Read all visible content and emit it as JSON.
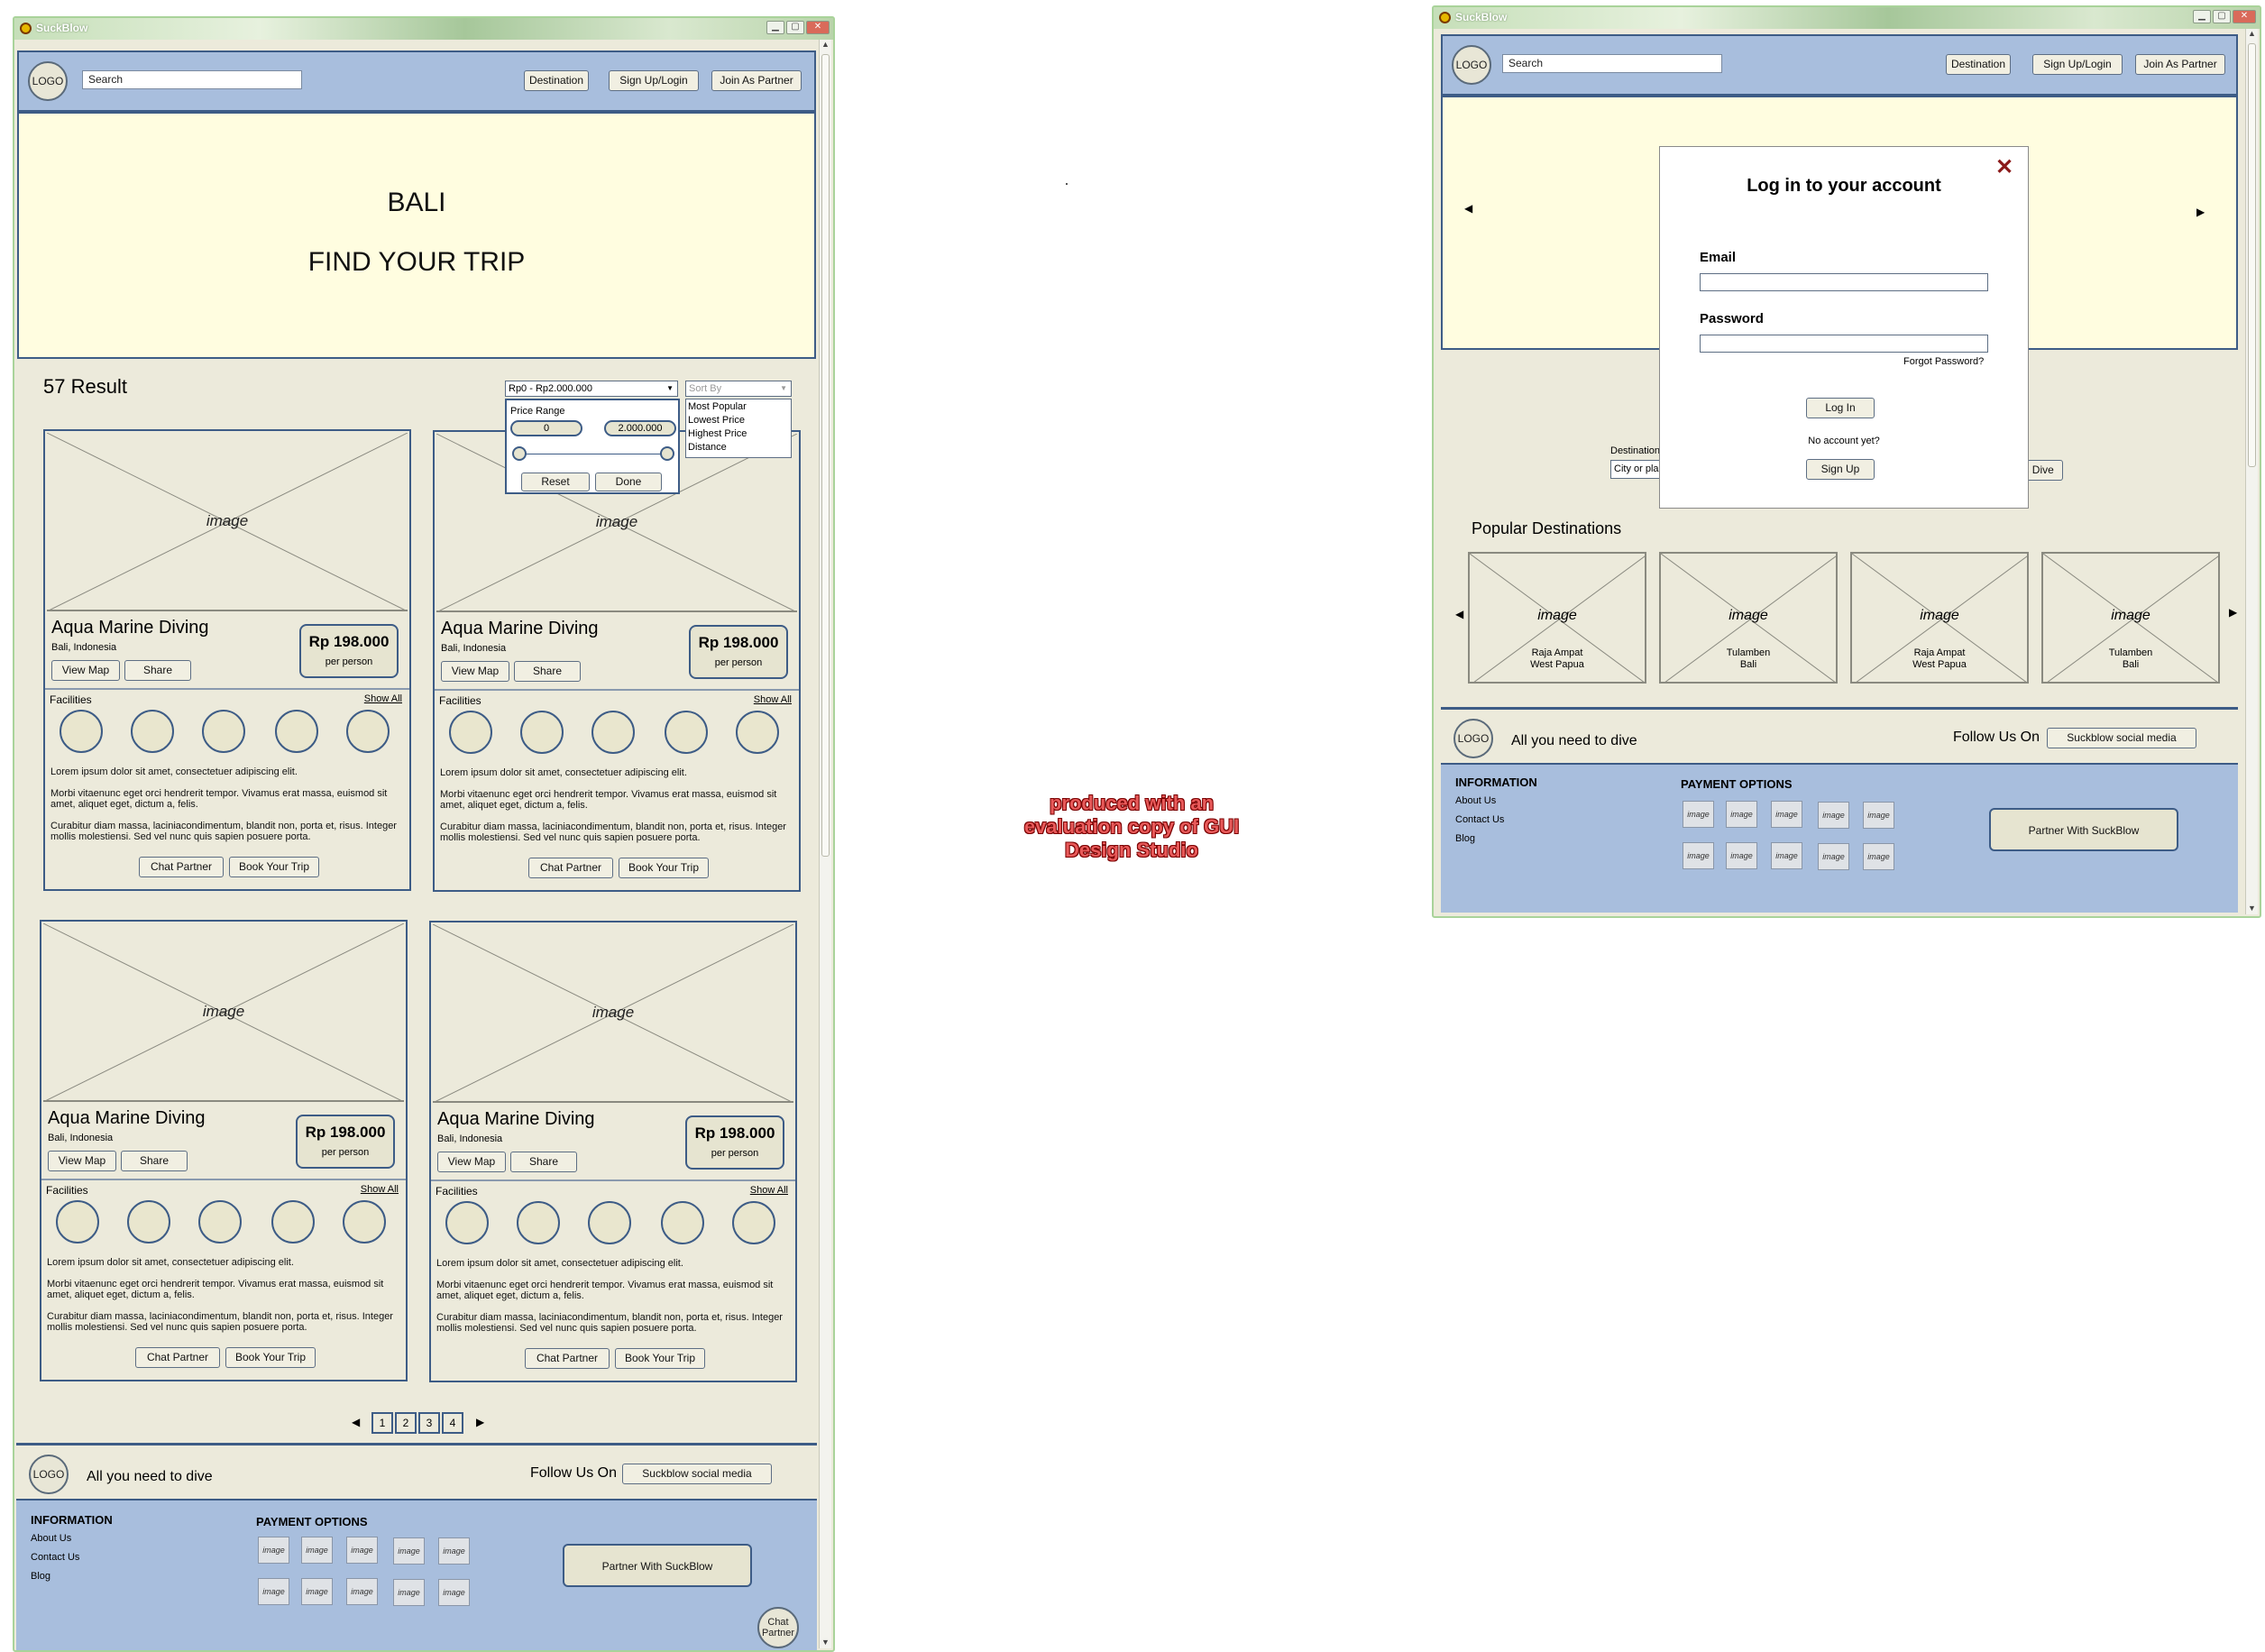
{
  "app": {
    "title": "SuckBlow"
  },
  "header": {
    "logo": "LOGO",
    "search_value": "Search",
    "destination": "Destination",
    "signup": "Sign Up/Login",
    "partner": "Join As Partner"
  },
  "hero": {
    "line1": "BALI",
    "line2": "FIND YOUR TRIP"
  },
  "results": {
    "count": "57 Result"
  },
  "filters": {
    "price_select": "Rp0 - Rp2.000.000",
    "sort_select": "Sort By",
    "price_panel": {
      "label": "Price Range",
      "min": "0",
      "max": "2.000.000",
      "reset": "Reset",
      "done": "Done"
    },
    "sort_options": [
      "Most Popular",
      "Lowest Price",
      "Highest Price",
      "Distance"
    ]
  },
  "cards": [
    {
      "image": "image",
      "name": "Aqua Marine Diving",
      "location": "Bali, Indonesia",
      "price": "Rp 198.000",
      "per": "per person",
      "view_map": "View Map",
      "share": "Share",
      "facilities": "Facilities",
      "show_all": "Show All",
      "p1": "Lorem ipsum dolor sit amet, consectetuer adipiscing elit.",
      "p2": "Morbi vitaenunc eget orci hendrerit tempor. Vivamus erat massa, euismod sit amet, aliquet eget, dictum a, felis.",
      "p3": "Curabitur diam massa, laciniacondimentum, blandit non, porta et, risus. Integer mollis molestiensi. Sed vel nunc quis sapien posuere porta.",
      "chat": "Chat Partner",
      "book": "Book Your Trip"
    },
    {
      "image": "image",
      "name": "Aqua Marine Diving",
      "location": "Bali, Indonesia",
      "price": "Rp 198.000",
      "per": "per person",
      "view_map": "View Map",
      "share": "Share",
      "facilities": "Facilities",
      "show_all": "Show All",
      "p1": "Lorem ipsum dolor sit amet, consectetuer adipiscing elit.",
      "p2": "Morbi vitaenunc eget orci hendrerit tempor. Vivamus erat massa, euismod sit amet, aliquet eget, dictum a, felis.",
      "p3": "Curabitur diam massa, laciniacondimentum, blandit non, porta et, risus. Integer mollis molestiensi. Sed vel nunc quis sapien posuere porta.",
      "chat": "Chat Partner",
      "book": "Book Your Trip"
    },
    {
      "image": "image",
      "name": "Aqua Marine Diving",
      "location": "Bali, Indonesia",
      "price": "Rp 198.000",
      "per": "per person",
      "view_map": "View Map",
      "share": "Share",
      "facilities": "Facilities",
      "show_all": "Show All",
      "p1": "Lorem ipsum dolor sit amet, consectetuer adipiscing elit.",
      "p2": "Morbi vitaenunc eget orci hendrerit tempor. Vivamus erat massa, euismod sit amet, aliquet eget, dictum a, felis.",
      "p3": "Curabitur diam massa, laciniacondimentum, blandit non, porta et, risus. Integer mollis molestiensi. Sed vel nunc quis sapien posuere porta.",
      "chat": "Chat Partner",
      "book": "Book Your Trip"
    },
    {
      "image": "image",
      "name": "Aqua Marine Diving",
      "location": "Bali, Indonesia",
      "price": "Rp 198.000",
      "per": "per person",
      "view_map": "View Map",
      "share": "Share",
      "facilities": "Facilities",
      "show_all": "Show All",
      "p1": "Lorem ipsum dolor sit amet, consectetuer adipiscing elit.",
      "p2": "Morbi vitaenunc eget orci hendrerit tempor. Vivamus erat massa, euismod sit amet, aliquet eget, dictum a, felis.",
      "p3": "Curabitur diam massa, laciniacondimentum, blandit non, porta et, risus. Integer mollis molestiensi. Sed vel nunc quis sapien posuere porta.",
      "chat": "Chat Partner",
      "book": "Book Your Trip"
    }
  ],
  "pagination": {
    "pages": [
      "1",
      "2",
      "3",
      "4"
    ]
  },
  "footer": {
    "logo": "LOGO",
    "tagline": "All you need to dive",
    "follow": "Follow Us On",
    "social": "Suckblow social media",
    "info_title": "INFORMATION",
    "links": [
      "About Us",
      "Contact Us",
      "Blog"
    ],
    "payment_title": "PAYMENT OPTIONS",
    "payment_image": "image",
    "partner_btn": "Partner With SuckBlow",
    "chat_bubble": "Chat Partner"
  },
  "watermark": "produced with an evaluation copy of GUI Design Studio",
  "second": {
    "title": "SuckBlow",
    "search_value": "Search",
    "popular_title": "Popular Destinations",
    "destinations": [
      {
        "image": "image",
        "line1": "Raja Ampat",
        "line2": "West Papua"
      },
      {
        "image": "image",
        "line1": "Tulamben",
        "line2": "Bali"
      },
      {
        "image": "image",
        "line1": "Raja Ampat",
        "line2": "West Papua"
      },
      {
        "image": "image",
        "line1": "Tulamben",
        "line2": "Bali"
      }
    ],
    "hidden_dest_label": "Destination",
    "hidden_dest_placeholder": "City or pla",
    "hidden_btn": "'s Dive",
    "modal": {
      "close": "✕",
      "title": "Log in to your account",
      "email_label": "Email",
      "password_label": "Password",
      "forgot": "Forgot Password?",
      "login_btn": "Log In",
      "no_account": "No account yet?",
      "signup_btn": "Sign Up"
    }
  },
  "colors": {
    "header_bg": "#a8bedd",
    "hero_bg": "#fffde0",
    "page_bg": "#eceadb",
    "border": "#3d5c86",
    "close_x": "#8b1a1a",
    "window_frame": "#a9d39a"
  }
}
